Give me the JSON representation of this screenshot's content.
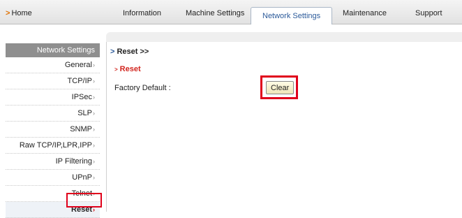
{
  "topnav": {
    "home": "Home",
    "tabs": [
      {
        "label": "Information"
      },
      {
        "label": "Machine Settings"
      },
      {
        "label": "Network Settings",
        "active": true
      },
      {
        "label": "Maintenance"
      },
      {
        "label": "Support"
      }
    ]
  },
  "sidebar": {
    "header": "Network Settings",
    "items": [
      {
        "label": "General"
      },
      {
        "label": "TCP/IP"
      },
      {
        "label": "IPSec"
      },
      {
        "label": "SLP"
      },
      {
        "label": "SNMP"
      },
      {
        "label": "Raw TCP/IP,LPR,IPP"
      },
      {
        "label": "IP Filtering"
      },
      {
        "label": "UPnP"
      },
      {
        "label": "Telnet"
      },
      {
        "label": "Reset",
        "active": true
      }
    ]
  },
  "main": {
    "page_title": "Reset >>",
    "section_title": "Reset",
    "factory_default_label": "Factory Default :",
    "clear_button": "Clear"
  },
  "colors": {
    "accent_orange": "#e07000",
    "highlight_red": "#e0001b",
    "section_red": "#d2261f"
  }
}
